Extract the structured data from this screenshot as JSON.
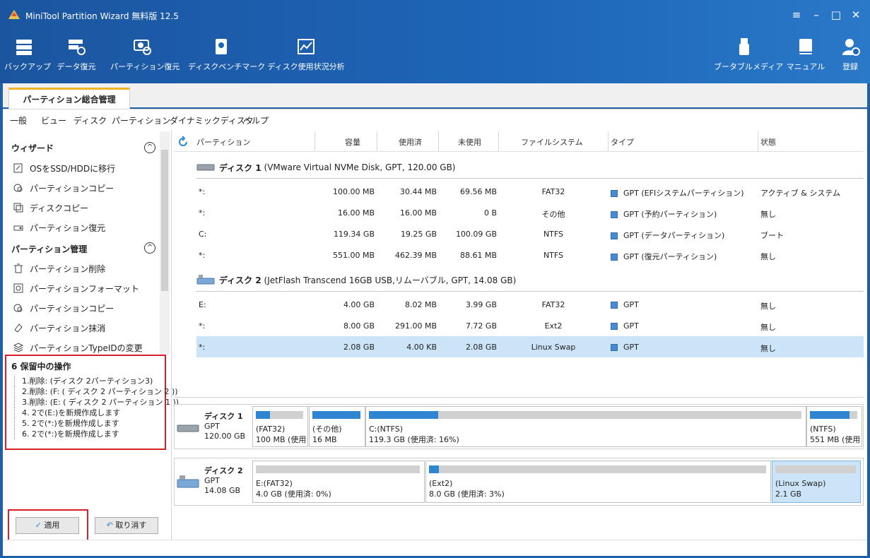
{
  "window": {
    "title": "MiniTool Partition Wizard 無料版 12.5"
  },
  "toolbar": {
    "left": [
      {
        "label": "バックアップ",
        "icon": "backup-icon"
      },
      {
        "label": "データ復元",
        "icon": "data-recovery-icon"
      },
      {
        "label": "パーティション復元",
        "icon": "partition-recovery-icon"
      },
      {
        "label": "ディスクベンチマーク",
        "icon": "disk-benchmark-icon"
      },
      {
        "label": "ディスク使用状況分析",
        "icon": "space-analyzer-icon"
      }
    ],
    "right": [
      {
        "label": "ブータブルメディア",
        "icon": "bootable-media-icon"
      },
      {
        "label": "マニュアル",
        "icon": "manual-icon"
      },
      {
        "label": "登録",
        "icon": "register-icon"
      }
    ]
  },
  "tab": {
    "label": "パーティション総合管理"
  },
  "menu": [
    "一般",
    "ビュー",
    "ディスク",
    "パーティション",
    "ダイナミックディスク",
    "ヘルプ"
  ],
  "sidebar": {
    "wizard": {
      "title": "ウィザード",
      "items": [
        "OSをSSD/HDDに移行",
        "パーティションコピー",
        "ディスクコピー",
        "パーティション復元"
      ]
    },
    "manage": {
      "title": "パーティション管理",
      "items": [
        "パーティション削除",
        "パーティションフォーマット",
        "パーティションコピー",
        "パーティション抹消",
        "パーティションTypeIDの変更"
      ]
    },
    "pending": {
      "title": "6 保留中の操作",
      "ops": [
        "1.削除: (ディスク 2パーティション3)",
        "2.削除: (F: ( ディスク 2 パーティション 2 ))",
        "3.削除: (E: ( ディスク 2 パーティション 1 ))",
        "4. 2で(E:)を新規作成します",
        "5. 2で(*:)を新規作成します",
        "6. 2で(*:)を新規作成します"
      ]
    },
    "apply_label": "適用",
    "undo_label": "取り消す"
  },
  "table": {
    "headers": [
      "パーティション",
      "容量",
      "使用済",
      "未使用",
      "ファイルシステム",
      "タイプ",
      "状態"
    ],
    "disks": [
      {
        "name": "ディスク 1",
        "desc": "(VMware Virtual NVMe Disk, GPT, 120.00 GB)",
        "rows": [
          [
            "*:",
            "100.00 MB",
            "30.44 MB",
            "69.56 MB",
            "FAT32",
            "GPT (EFIシステムパーティション)",
            "アクティブ & システム"
          ],
          [
            "*:",
            "16.00 MB",
            "16.00 MB",
            "0 B",
            "その他",
            "GPT (予約パーティション)",
            "無し"
          ],
          [
            "C:",
            "119.34 GB",
            "19.25 GB",
            "100.09 GB",
            "NTFS",
            "GPT (データパーティション)",
            "ブート"
          ],
          [
            "*:",
            "551.00 MB",
            "462.39 MB",
            "88.61 MB",
            "NTFS",
            "GPT (復元パーティション)",
            "無し"
          ]
        ]
      },
      {
        "name": "ディスク 2",
        "desc": "(JetFlash Transcend 16GB USB,リムーバブル, GPT, 14.08 GB)",
        "rows": [
          [
            "E:",
            "4.00 GB",
            "8.02 MB",
            "3.99 GB",
            "FAT32",
            "GPT",
            "無し"
          ],
          [
            "*:",
            "8.00 GB",
            "291.00 MB",
            "7.72 GB",
            "Ext2",
            "GPT",
            "無し"
          ],
          [
            "*:",
            "2.08 GB",
            "4.00 KB",
            "2.08 GB",
            "Linux Swap",
            "GPT",
            "無し"
          ]
        ]
      }
    ]
  },
  "diskmap": [
    {
      "name": "ディスク 1",
      "type": "GPT",
      "size": "120.00 GB",
      "parts": [
        {
          "l1": "(FAT32)",
          "l2": "100 MB (使用",
          "used": 0.3
        },
        {
          "l1": "(その他)",
          "l2": "16 MB",
          "used": 1.0
        },
        {
          "l1": "C:(NTFS)",
          "l2": "119.3 GB (使用済: 16%)",
          "used": 0.16
        },
        {
          "l1": "(NTFS)",
          "l2": "551 MB (使用",
          "used": 0.84
        }
      ]
    },
    {
      "name": "ディスク 2",
      "type": "GPT",
      "size": "14.08 GB",
      "parts": [
        {
          "l1": "E:(FAT32)",
          "l2": "4.0 GB (使用済: 0%)",
          "used": 0.0
        },
        {
          "l1": "(Ext2)",
          "l2": "8.0 GB (使用済: 3%)",
          "used": 0.03
        },
        {
          "l1": "(Linux Swap)",
          "l2": "2.1 GB",
          "used": 0.0
        }
      ]
    }
  ],
  "colors": {
    "accent": "#2e86d2",
    "highlight": "#d7202a",
    "selection": "#cce4f7"
  }
}
